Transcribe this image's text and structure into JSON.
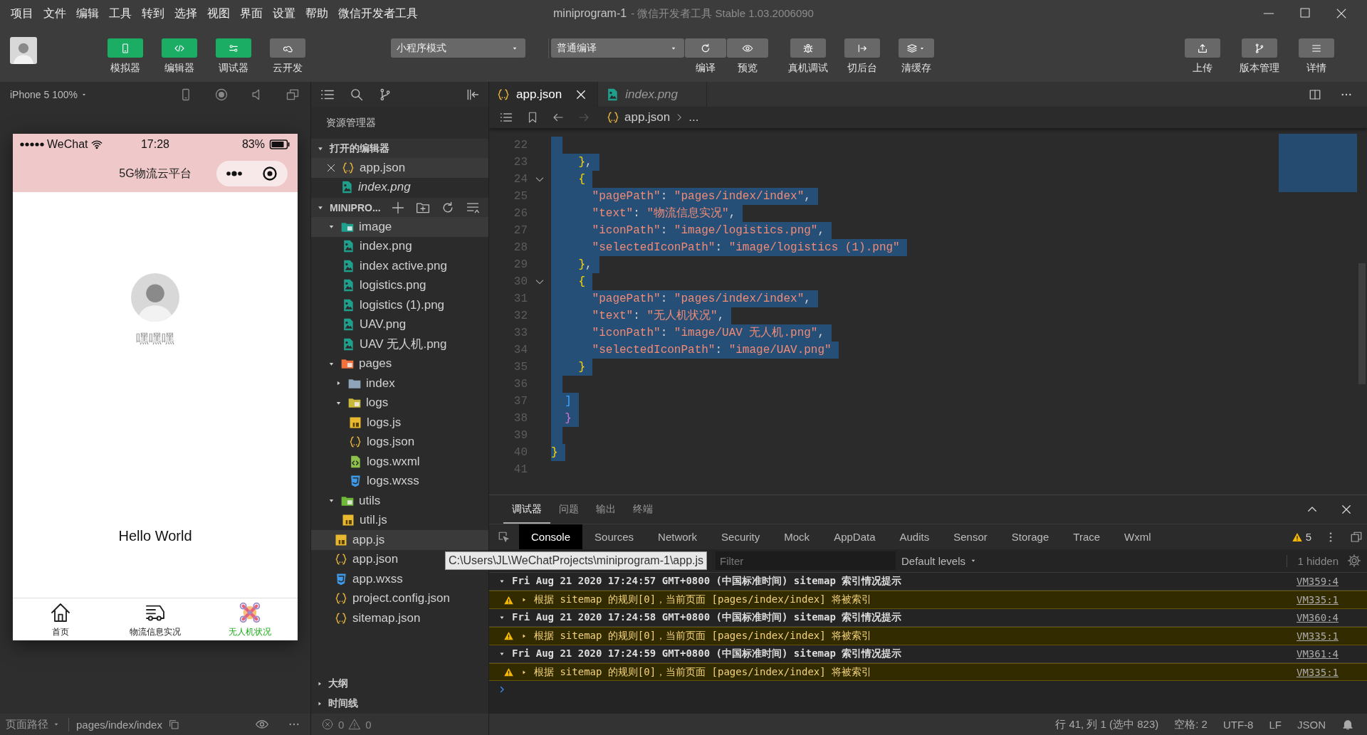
{
  "menu": [
    "项目",
    "文件",
    "编辑",
    "工具",
    "转到",
    "选择",
    "视图",
    "界面",
    "设置",
    "帮助",
    "微信开发者工具"
  ],
  "window": {
    "title": "miniprogram-1",
    "subtitle": "- 微信开发者工具 Stable 1.03.2006090"
  },
  "toolbar": {
    "panels": [
      {
        "label": "模拟器",
        "on": true
      },
      {
        "label": "编辑器",
        "on": true
      },
      {
        "label": "调试器",
        "on": true
      },
      {
        "label": "云开发",
        "on": false
      }
    ],
    "mode": "小程序模式",
    "compile": "普通编译",
    "compile_actions": [
      {
        "label": "编译"
      },
      {
        "label": "预览"
      }
    ],
    "actions": [
      {
        "label": "真机调试"
      },
      {
        "label": "切后台"
      },
      {
        "label": "清缓存"
      }
    ],
    "right": [
      {
        "label": "上传"
      },
      {
        "label": "版本管理"
      },
      {
        "label": "详情"
      }
    ]
  },
  "simulator": {
    "device": "iPhone 5 100%",
    "phone": {
      "carrier": "WeChat",
      "time": "17:28",
      "battery": "83%",
      "title": "5G物流云平台",
      "name": "嘿嘿嘿",
      "greeting": "Hello World",
      "tabs": [
        {
          "label": "首页",
          "selected": false
        },
        {
          "label": "物流信息实况",
          "selected": false
        },
        {
          "label": "无人机状况",
          "selected": true
        }
      ]
    },
    "path_label": "页面路径",
    "path": "pages/index/index"
  },
  "explorer": {
    "title": "资源管理器",
    "open_editors": {
      "label": "打开的编辑器",
      "expanded": true,
      "items": [
        {
          "name": "app.json",
          "kind": "json",
          "selected": true,
          "preview": false
        },
        {
          "name": "index.png",
          "kind": "image",
          "selected": false,
          "preview": true
        }
      ]
    },
    "project": {
      "label": "MINIPRO...",
      "expanded": true,
      "tree": [
        {
          "kind": "image-folder",
          "name": "image",
          "expanded": true,
          "selected": true,
          "children": [
            {
              "kind": "image",
              "name": "index.png",
              "selected": false
            },
            {
              "kind": "image",
              "name": "index active.png",
              "selected": false
            },
            {
              "kind": "image",
              "name": "logistics.png",
              "selected": false
            },
            {
              "kind": "image",
              "name": "logistics (1).png",
              "selected": false
            },
            {
              "kind": "image",
              "name": "UAV.png",
              "selected": false
            },
            {
              "kind": "image",
              "name": "UAV 无人机.png",
              "selected": false
            }
          ]
        },
        {
          "kind": "pages-folder",
          "name": "pages",
          "expanded": true,
          "selected": false,
          "children": [
            {
              "kind": "folder",
              "name": "index",
              "expanded": false,
              "selected": false
            },
            {
              "kind": "logs-folder",
              "name": "logs",
              "expanded": true,
              "selected": false,
              "children": [
                {
                  "kind": "js",
                  "name": "logs.js",
                  "selected": false
                },
                {
                  "kind": "json",
                  "name": "logs.json",
                  "selected": false
                },
                {
                  "kind": "wxml",
                  "name": "logs.wxml",
                  "selected": false
                },
                {
                  "kind": "wxss",
                  "name": "logs.wxss",
                  "selected": false
                }
              ]
            }
          ]
        },
        {
          "kind": "utils-folder",
          "name": "utils",
          "expanded": true,
          "selected": false,
          "children": [
            {
              "kind": "js",
              "name": "util.js",
              "selected": false
            }
          ]
        },
        {
          "kind": "js",
          "name": "app.js",
          "selected": true
        },
        {
          "kind": "json",
          "name": "app.json",
          "selected": false
        },
        {
          "kind": "wxss",
          "name": "app.wxss",
          "selected": false
        },
        {
          "kind": "json",
          "name": "project.config.json",
          "selected": false
        },
        {
          "kind": "json",
          "name": "sitemap.json",
          "selected": false
        }
      ]
    },
    "sections": [
      {
        "label": "大纲",
        "expanded": false
      },
      {
        "label": "时间线",
        "expanded": false
      }
    ],
    "errors": "0",
    "warnings": "0",
    "tooltip": "C:\\Users\\JL\\WeChatProjects\\miniprogram-1\\app.js"
  },
  "editor": {
    "tabs": [
      {
        "name": "app.json",
        "kind": "json",
        "selected": true,
        "preview": false
      },
      {
        "name": "index.png",
        "kind": "image",
        "selected": false,
        "preview": true
      }
    ],
    "breadcrumb": {
      "file": "app.json",
      "rest": "..."
    },
    "lines": [
      {
        "n": "22",
        "selected": true,
        "fold": false
      },
      {
        "n": "23",
        "selected": true,
        "fold": false,
        "text": "    },"
      },
      {
        "n": "24",
        "selected": true,
        "fold": true,
        "text": "    {"
      },
      {
        "n": "25",
        "selected": true,
        "fold": false,
        "text": "      \"pagePath\": \"pages/index/index\","
      },
      {
        "n": "26",
        "selected": true,
        "fold": false,
        "text": "      \"text\": \"物流信息实况\","
      },
      {
        "n": "27",
        "selected": true,
        "fold": false,
        "text": "      \"iconPath\": \"image/logistics.png\","
      },
      {
        "n": "28",
        "selected": true,
        "fold": false,
        "text": "      \"selectedIconPath\": \"image/logistics (1).png\""
      },
      {
        "n": "29",
        "selected": true,
        "fold": false,
        "text": "    },"
      },
      {
        "n": "30",
        "selected": true,
        "fold": true,
        "text": "    {"
      },
      {
        "n": "31",
        "selected": true,
        "fold": false,
        "text": "      \"pagePath\": \"pages/index/index\","
      },
      {
        "n": "32",
        "selected": true,
        "fold": false,
        "text": "      \"text\": \"无人机状况\","
      },
      {
        "n": "33",
        "selected": true,
        "fold": false,
        "text": "      \"iconPath\": \"image/UAV 无人机.png\","
      },
      {
        "n": "34",
        "selected": true,
        "fold": false,
        "text": "      \"selectedIconPath\": \"image/UAV.png\""
      },
      {
        "n": "35",
        "selected": true,
        "fold": false,
        "text": "    }"
      },
      {
        "n": "36",
        "selected": true,
        "fold": false
      },
      {
        "n": "37",
        "selected": true,
        "fold": false,
        "text": "  ]"
      },
      {
        "n": "38",
        "selected": true,
        "fold": false,
        "text": "  }"
      },
      {
        "n": "39",
        "selected": true,
        "fold": false
      },
      {
        "n": "40",
        "selected": true,
        "fold": false,
        "text": "}"
      },
      {
        "n": "41",
        "selected": false,
        "fold": false
      }
    ]
  },
  "console": {
    "panel_tabs": [
      {
        "label": "调试器",
        "selected": true
      },
      {
        "label": "问题",
        "selected": false
      },
      {
        "label": "输出",
        "selected": false
      },
      {
        "label": "终端",
        "selected": false
      }
    ],
    "tabs": [
      {
        "label": "Console",
        "selected": true
      },
      {
        "label": "Sources",
        "selected": false
      },
      {
        "label": "Network",
        "selected": false
      },
      {
        "label": "Security",
        "selected": false
      },
      {
        "label": "Mock",
        "selected": false
      },
      {
        "label": "AppData",
        "selected": false
      },
      {
        "label": "Audits",
        "selected": false
      },
      {
        "label": "Sensor",
        "selected": false
      },
      {
        "label": "Storage",
        "selected": false
      },
      {
        "label": "Trace",
        "selected": false
      },
      {
        "label": "Wxml",
        "selected": false
      }
    ],
    "warning_count": "5",
    "filter_placeholder": "Filter",
    "levels": "Default levels",
    "hidden": "1 hidden",
    "entries": [
      {
        "kind": "group",
        "expanded": true,
        "text": "Fri Aug 21 2020 17:24:57 GMT+0800 (中国标准时间) sitemap 索引情况提示",
        "source": "VM359:4"
      },
      {
        "kind": "warning",
        "expanded": false,
        "text": "根据 sitemap 的规则[0]，当前页面 [pages/index/index] 将被索引",
        "source": "VM335:1"
      },
      {
        "kind": "group",
        "expanded": true,
        "text": "Fri Aug 21 2020 17:24:58 GMT+0800 (中国标准时间) sitemap 索引情况提示",
        "source": "VM360:4"
      },
      {
        "kind": "warning",
        "expanded": false,
        "text": "根据 sitemap 的规则[0]，当前页面 [pages/index/index] 将被索引",
        "source": "VM335:1"
      },
      {
        "kind": "group",
        "expanded": true,
        "text": "Fri Aug 21 2020 17:24:59 GMT+0800 (中国标准时间) sitemap 索引情况提示",
        "source": "VM361:4"
      },
      {
        "kind": "warning",
        "expanded": false,
        "text": "根据 sitemap 的规则[0]，当前页面 [pages/index/index] 将被索引",
        "source": "VM335:1"
      }
    ]
  },
  "status_bar": [
    "行 41, 列 1 (选中 823)",
    "空格: 2",
    "UTF-8",
    "LF",
    "JSON"
  ]
}
